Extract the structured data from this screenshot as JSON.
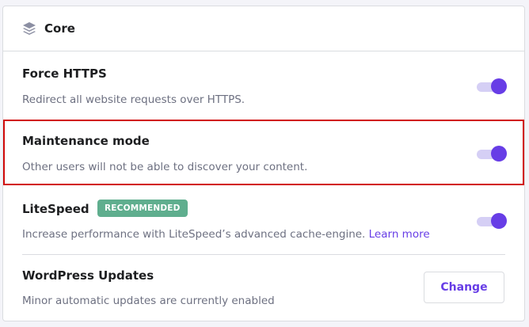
{
  "header": {
    "icon": "layers-icon",
    "title": "Core"
  },
  "settings": [
    {
      "title": "Force HTTPS",
      "description": "Redirect all website requests over HTTPS.",
      "toggle_on": true
    },
    {
      "title": "Maintenance mode",
      "description": "Other users will not be able to discover your content.",
      "toggle_on": true
    },
    {
      "title": "LiteSpeed",
      "badge": "RECOMMENDED",
      "description": "Increase performance with LiteSpeed’s advanced cache-engine.",
      "link": "Learn more",
      "toggle_on": true
    },
    {
      "title": "WordPress Updates",
      "description": "Minor automatic updates are currently enabled",
      "button": "Change"
    }
  ],
  "colors": {
    "accent": "#673de6",
    "toggle_track": "#d5cff5",
    "badge_bg": "#5fae8e",
    "highlight_border": "#d10a0a"
  }
}
